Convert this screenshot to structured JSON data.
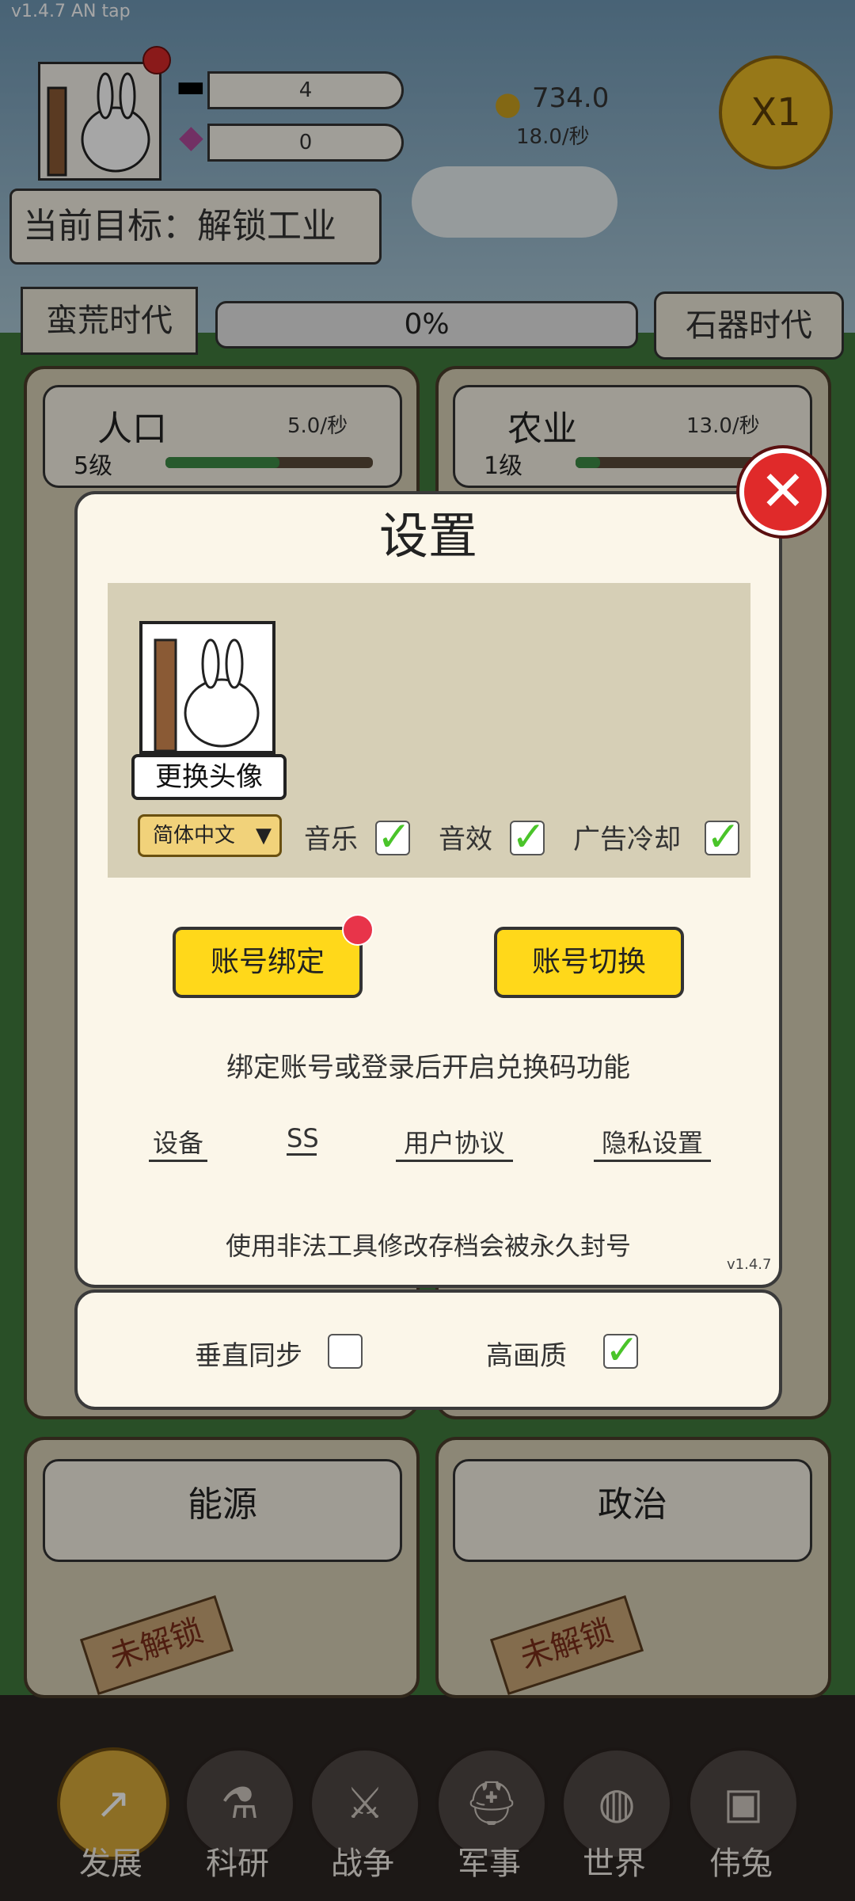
{
  "status_bar": {
    "version_text": "v1.4.7 AN tap"
  },
  "header": {
    "stone_count": "4",
    "gem_count": "0",
    "coins": "734.0",
    "coin_rate": "18.0/秒",
    "speed_label": "X1",
    "goal_text": "当前目标：解锁工业",
    "era_current": "蛮荒时代",
    "era_progress": "0%",
    "era_next": "石器时代"
  },
  "panels": {
    "population": {
      "name": "人口",
      "rate": "5.0/秒",
      "level": "5级",
      "progress": 0.55
    },
    "agriculture": {
      "name": "农业",
      "rate": "13.0/秒",
      "level": "1级",
      "progress": 0.12
    },
    "energy": {
      "name": "能源",
      "lock": "未解锁"
    },
    "politics": {
      "name": "政治",
      "lock": "未解锁"
    }
  },
  "settings": {
    "title": "设置",
    "change_avatar": "更换头像",
    "language": "简体中文",
    "music_label": "音乐",
    "sfx_label": "音效",
    "ad_cooldown_label": "广告冷却",
    "bind_account": "账号绑定",
    "switch_account": "账号切换",
    "bind_note": "绑定账号或登录后开启兑换码功能",
    "links": [
      "设备",
      "SS",
      "用户协议",
      "隐私设置"
    ],
    "warning": "使用非法工具修改存档会被永久封号",
    "version": "v1.4.7",
    "vsync_label": "垂直同步",
    "hq_label": "高画质"
  },
  "nav": [
    "发展",
    "科研",
    "战争",
    "军事",
    "世界",
    "伟兔"
  ],
  "icons": {
    "close": "close-icon",
    "stone": "stone-icon",
    "gem": "gem-icon",
    "coin": "coin-icon"
  },
  "colors": {
    "accent_yellow": "#ffd81a",
    "close_red": "#e02a2a",
    "check_green": "#4ac42a"
  }
}
